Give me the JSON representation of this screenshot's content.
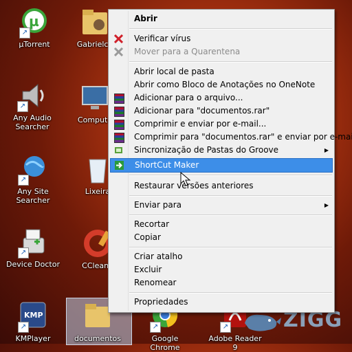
{
  "desktop": {
    "icons": [
      {
        "label": "µTorrent"
      },
      {
        "label": "Gabrielce"
      },
      {
        "label": "Any Audio Searcher"
      },
      {
        "label": "Computa"
      },
      {
        "label": "Any Site Searcher"
      },
      {
        "label": "Lixeira"
      },
      {
        "label": "Device Doctor"
      },
      {
        "label": "CCleane"
      },
      {
        "label": "KMPlayer"
      },
      {
        "label": "documentos"
      },
      {
        "label": "Google Chrome"
      },
      {
        "label": "Adobe Reader 9"
      }
    ],
    "watermark": "ZIGG"
  },
  "context_menu": {
    "items": [
      {
        "label": "Abrir"
      },
      {
        "label": "Verificar vírus"
      },
      {
        "label": "Mover para a Quarentena"
      },
      {
        "label": "Abrir local de pasta"
      },
      {
        "label": "Abrir como Bloco de Anotações no OneNote"
      },
      {
        "label": "Adicionar para o arquivo..."
      },
      {
        "label": "Adicionar para \"documentos.rar\""
      },
      {
        "label": "Comprimir e enviar por e-mail..."
      },
      {
        "label": "Comprimir para \"documentos.rar\" e enviar por e-mail"
      },
      {
        "label": "Sincronização de Pastas do Groove"
      },
      {
        "label": "ShortCut Maker"
      },
      {
        "label": "Restaurar versões anteriores"
      },
      {
        "label": "Enviar para"
      },
      {
        "label": "Recortar"
      },
      {
        "label": "Copiar"
      },
      {
        "label": "Criar atalho"
      },
      {
        "label": "Excluir"
      },
      {
        "label": "Renomear"
      },
      {
        "label": "Propriedades"
      }
    ],
    "highlight_color": "#3d8ee8"
  }
}
